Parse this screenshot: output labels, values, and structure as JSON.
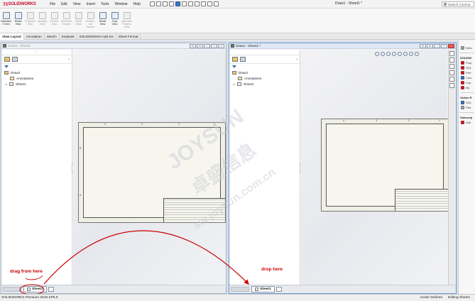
{
  "app": {
    "logo_prefix": "3S",
    "logo_text": "SOLIDWORKS",
    "menu": [
      "File",
      "Edit",
      "View",
      "Insert",
      "Tools",
      "Window",
      "Help"
    ],
    "document_title": "Draw1 - Sheet1 *",
    "search_placeholder": "Search Comma"
  },
  "ribbon": {
    "buttons": [
      {
        "label": "Standard 3 View",
        "enabled": true
      },
      {
        "label": "Model View",
        "enabled": true
      },
      {
        "label": "Projected View",
        "enabled": false
      },
      {
        "label": "Auxiliary View",
        "enabled": false
      },
      {
        "label": "Section View",
        "enabled": false
      },
      {
        "label": "Removed Section",
        "enabled": false
      },
      {
        "label": "Detail View",
        "enabled": false
      },
      {
        "label": "Broken-out Section",
        "enabled": false
      },
      {
        "label": "Break View",
        "enabled": true
      },
      {
        "label": "Crop View",
        "enabled": true
      },
      {
        "label": "Alternate Position View",
        "enabled": false
      }
    ]
  },
  "command_tabs": [
    "View Layout",
    "Annotation",
    "Sketch",
    "Evaluate",
    "SOLIDWORKS Add-Ins",
    "Sheet Format"
  ],
  "left_window": {
    "title": "Draw2 - Sheet1",
    "tree": {
      "root": "Draw2",
      "items": [
        "Annotations",
        "Sheet1"
      ]
    },
    "sheet_tab": "Sheet1"
  },
  "right_window": {
    "title": "Draw1 - Sheet1 *",
    "tree": {
      "root": "Draw1",
      "items": [
        "Annotations",
        "Sheet1"
      ]
    },
    "sheet_tab": "Sheet1"
  },
  "task_pane": {
    "groups": [
      {
        "items": [
          "Welc"
        ]
      },
      {
        "title": "SOLIDW",
        "items": [
          "Prop",
          "SOL",
          "Perf",
          "Com",
          "Cop",
          "My"
        ]
      },
      {
        "title": "Online R",
        "items": [
          "SOL",
          "Part"
        ]
      },
      {
        "title": "Subscrip",
        "items": [
          "Sub"
        ]
      }
    ]
  },
  "annotations": {
    "drag": "drag from here",
    "drop": "drop here"
  },
  "watermark": {
    "latin": "JOYSUN",
    "cjk": "卓盛信息",
    "url": "sw.joysun.com.cn"
  },
  "status": {
    "version": "SOLIDWORKS Premium 2019 SP5.0",
    "state": "Under Defined",
    "mode": "Editing Sheet1"
  },
  "colors": {
    "brand": "#c8102e",
    "annotation": "#cc0000",
    "active_frame": "#6a9ad0"
  }
}
